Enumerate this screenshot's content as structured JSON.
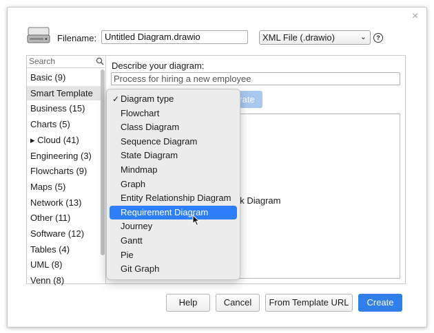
{
  "dialog": {
    "close_glyph": "×",
    "filename_label": "Filename:",
    "filename_value": "Untitled Diagram.drawio",
    "format_selected": "XML File (.drawio)",
    "help_glyph": "?"
  },
  "sidebar": {
    "search_placeholder": "Search",
    "items": [
      {
        "label": "Basic (9)"
      },
      {
        "label": "Smart Template"
      },
      {
        "label": "Business (15)"
      },
      {
        "label": "Charts (5)"
      },
      {
        "label": "▸ Cloud (41)"
      },
      {
        "label": "Engineering (3)"
      },
      {
        "label": "Flowcharts (9)"
      },
      {
        "label": "Maps (5)"
      },
      {
        "label": "Network (13)"
      },
      {
        "label": "Other (11)"
      },
      {
        "label": "Software (12)"
      },
      {
        "label": "Tables (4)"
      },
      {
        "label": "UML (8)"
      },
      {
        "label": "Venn (8)"
      }
    ],
    "selected_index": 1
  },
  "main": {
    "describe_label": "Describe your diagram:",
    "describe_value": "Process for hiring a new employee",
    "generate_button_partial": "rate",
    "preview_partial_text": "nk Diagram"
  },
  "dropdown": {
    "check_glyph": "✓",
    "items": [
      {
        "label": "Diagram type"
      },
      {
        "label": "Flowchart"
      },
      {
        "label": "Class Diagram"
      },
      {
        "label": "Sequence Diagram"
      },
      {
        "label": "State Diagram"
      },
      {
        "label": "Mindmap"
      },
      {
        "label": "Graph"
      },
      {
        "label": "Entity Relationship Diagram"
      },
      {
        "label": "Requirement Diagram"
      },
      {
        "label": "Journey"
      },
      {
        "label": "Gantt"
      },
      {
        "label": "Pie"
      },
      {
        "label": "Git Graph"
      }
    ],
    "checked_index": 0,
    "highlighted_index": 8
  },
  "buttons": {
    "help": "Help",
    "cancel": "Cancel",
    "from_template_url": "From Template URL",
    "create": "Create"
  },
  "colors": {
    "accent": "#2f7ee9",
    "highlight": "#2d7ff9",
    "generate_disabled": "#a8c8f0"
  },
  "icons": [
    "drive-icon",
    "search-icon",
    "help-icon",
    "close-icon",
    "check-icon",
    "pointer-cursor-icon"
  ]
}
